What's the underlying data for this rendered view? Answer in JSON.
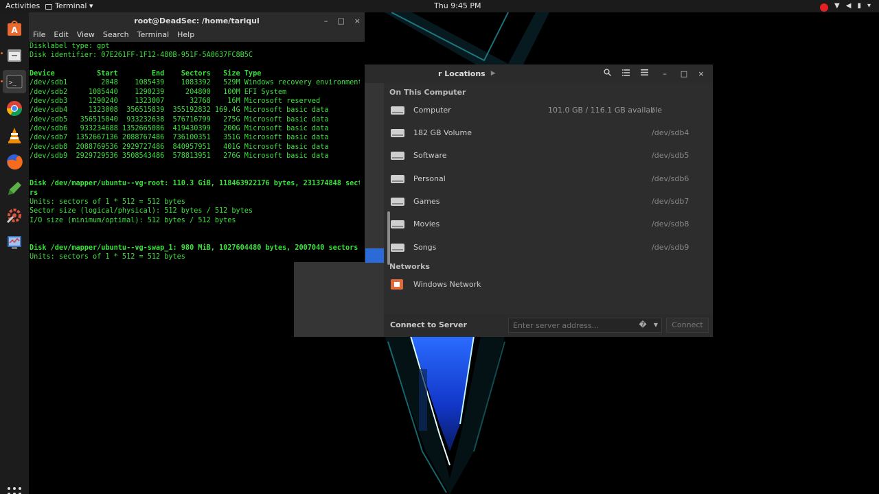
{
  "topbar": {
    "activities": "Activities",
    "app_menu": "Terminal ▾",
    "clock": "Thu  9:45 PM"
  },
  "dock": {
    "items": [
      "ubuntu-software",
      "files",
      "terminal",
      "chrome",
      "vlc",
      "firefox",
      "gedit",
      "settings",
      "system-monitor"
    ]
  },
  "terminal": {
    "title": "root@DeadSec: /home/tariqul",
    "menu": [
      "File",
      "Edit",
      "View",
      "Search",
      "Terminal",
      "Help"
    ],
    "lines": [
      {
        "text": "Disklabel type: gpt",
        "bold": false
      },
      {
        "text": "Disk identifier: 07E261FF-1F12-480B-951F-5A0637FC8B5C",
        "bold": false
      },
      {
        "text": "",
        "bold": false
      },
      {
        "text": "Device          Start        End    Sectors   Size Type",
        "bold": true
      },
      {
        "text": "/dev/sdb1        2048    1085439    1083392   529M Windows recovery environment",
        "bold": false
      },
      {
        "text": "/dev/sdb2     1085440    1290239     204800   100M EFI System",
        "bold": false
      },
      {
        "text": "/dev/sdb3     1290240    1323007      32768    16M Microsoft reserved",
        "bold": false
      },
      {
        "text": "/dev/sdb4     1323008  356515839  355192832 169.4G Microsoft basic data",
        "bold": false
      },
      {
        "text": "/dev/sdb5   356515840  933232638  576716799   275G Microsoft basic data",
        "bold": false
      },
      {
        "text": "/dev/sdb6   933234688 1352665086  419430399   200G Microsoft basic data",
        "bold": false
      },
      {
        "text": "/dev/sdb7  1352667136 2088767486  736100351   351G Microsoft basic data",
        "bold": false
      },
      {
        "text": "/dev/sdb8  2088769536 2929727486  840957951   401G Microsoft basic data",
        "bold": false
      },
      {
        "text": "/dev/sdb9  2929729536 3508543486  578813951   276G Microsoft basic data",
        "bold": false
      },
      {
        "text": "",
        "bold": false
      },
      {
        "text": "",
        "bold": false
      },
      {
        "text": "Disk /dev/mapper/ubuntu--vg-root: 110.3 GiB, 118463922176 bytes, 231374848 secto",
        "bold": true
      },
      {
        "text": "rs",
        "bold": true
      },
      {
        "text": "Units: sectors of 1 * 512 = 512 bytes",
        "bold": false
      },
      {
        "text": "Sector size (logical/physical): 512 bytes / 512 bytes",
        "bold": false
      },
      {
        "text": "I/O size (minimum/optimal): 512 bytes / 512 bytes",
        "bold": false
      },
      {
        "text": "",
        "bold": false
      },
      {
        "text": "",
        "bold": false
      },
      {
        "text": "Disk /dev/mapper/ubuntu--vg-swap_1: 980 MiB, 1027604480 bytes, 2007040 sectors",
        "bold": true
      },
      {
        "text": "Units: sectors of 1 * 512 = 512 bytes",
        "bold": false
      }
    ]
  },
  "filemanager": {
    "path_label": "r Locations",
    "section_computer": "On This Computer",
    "drives": [
      {
        "label": "Computer",
        "info": "101.0 GB / 116.1 GB available",
        "dev": "/"
      },
      {
        "label": "182 GB Volume",
        "info": "",
        "dev": "/dev/sdb4"
      },
      {
        "label": "Software",
        "info": "",
        "dev": "/dev/sdb5"
      },
      {
        "label": "Personal",
        "info": "",
        "dev": "/dev/sdb6"
      },
      {
        "label": "Games",
        "info": "",
        "dev": "/dev/sdb7"
      },
      {
        "label": "Movies",
        "info": "",
        "dev": "/dev/sdb8"
      },
      {
        "label": "Songs",
        "info": "",
        "dev": "/dev/sdb9"
      }
    ],
    "section_networks": "Networks",
    "network_item": "Windows Network",
    "connect_label": "Connect to Server",
    "server_placeholder": "Enter server address...",
    "connect_button": "Connect"
  },
  "colors": {
    "terminal_text": "#3ce03c",
    "selection_blue": "#2a6bd8",
    "record_red": "#e52020"
  }
}
